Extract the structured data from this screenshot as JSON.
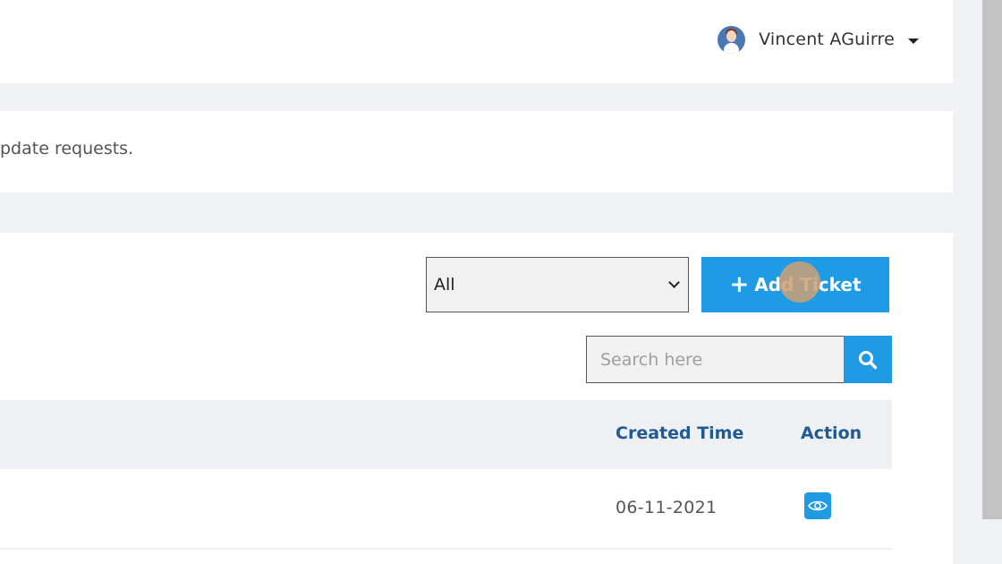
{
  "header": {
    "user_name": "Vincent AGuirre",
    "avatar_icon": "user-avatar",
    "dropdown_icon": "caret-down-icon"
  },
  "info": {
    "text": "pdate requests."
  },
  "toolbar": {
    "filter_value": "All",
    "filter_options": [
      "All"
    ],
    "add_ticket_icon": "plus-icon",
    "add_ticket_label": "Add Ticket",
    "search_placeholder": "Search here",
    "search_icon": "search-icon"
  },
  "table": {
    "columns": [
      "Created Time",
      "Action"
    ],
    "rows": [
      {
        "created_time": "06-11-2021",
        "action_icon": "eye-icon"
      }
    ]
  },
  "colors": {
    "accent": "#1f9be6",
    "header_text": "#1f5b92",
    "page_bg": "#f1f2f5"
  }
}
